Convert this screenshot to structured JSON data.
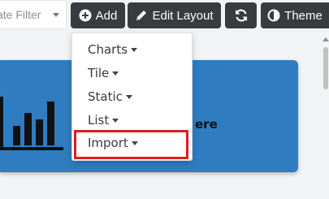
{
  "toolbar": {
    "date_filter_label": "ate Filter",
    "add_label": "Add",
    "edit_layout_label": "Edit Layout",
    "theme_label": "Theme"
  },
  "card": {
    "text": "ere"
  },
  "add_menu": {
    "items": [
      {
        "label": "Charts"
      },
      {
        "label": "Tile"
      },
      {
        "label": "Static"
      },
      {
        "label": "List"
      },
      {
        "label": "Import"
      }
    ]
  },
  "colors": {
    "button_bg": "#383b3f",
    "card_bg": "#2f7dc0",
    "highlight": "#e21b1b"
  },
  "icons": [
    "plus-circle-icon",
    "pencil-icon",
    "refresh-icon",
    "half-circle-theme-icon",
    "caret-down-icon",
    "bar-chart-icon"
  ]
}
